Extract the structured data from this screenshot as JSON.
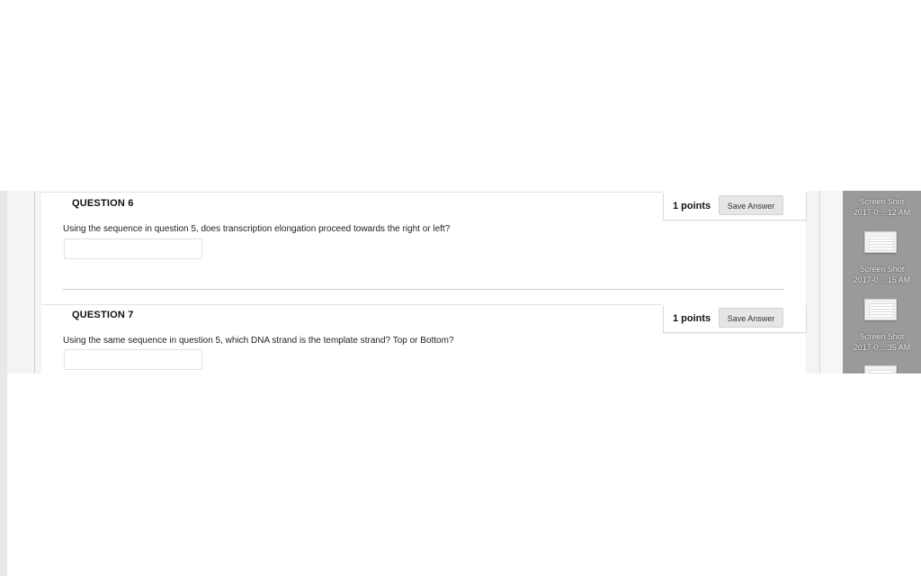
{
  "questions": [
    {
      "title": "QUESTION 6",
      "points": "1 points",
      "save_label": "Save Answer",
      "text": "Using the sequence in question 5, does transcription elongation proceed towards the right or left?",
      "answer_value": ""
    },
    {
      "title": "QUESTION 7",
      "points": "1 points",
      "save_label": "Save Answer",
      "text": "Using the same sequence in question 5, which DNA strand is the template strand? Top or Bottom?",
      "answer_value": ""
    }
  ],
  "sidebar": {
    "thumbnails": [
      {
        "name": "Screen Shot",
        "date": "2017-0....12 AM"
      },
      {
        "name": "Screen Shot",
        "date": "2017-0....15 AM"
      },
      {
        "name": "Screen Shot",
        "date": "2017-0....35 AM"
      }
    ]
  },
  "colors": {
    "sidebar_bg": "#9a9a9a",
    "button_bg": "#e6e6e6"
  }
}
